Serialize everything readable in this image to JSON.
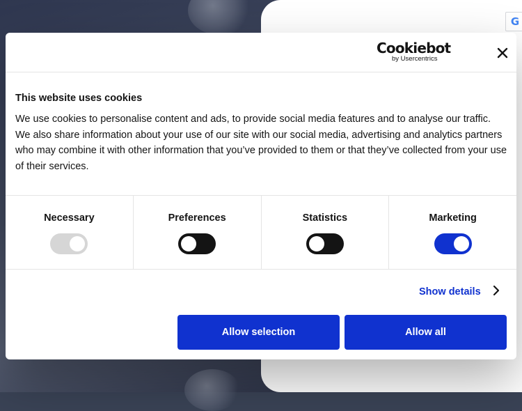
{
  "background": {
    "google_badge": "G",
    "colors": {
      "panel": "#ffffff",
      "accent_teal": "#22c9b1"
    }
  },
  "dialog": {
    "logo": {
      "main": "Cookiebot",
      "sub": "by Usercentrics"
    },
    "close_icon": "close-icon",
    "title": "This website uses cookies",
    "body": "We use cookies to personalise content and ads, to provide social media features and to analyse our traffic. We also share information about your use of our site with our social media, advertising and analytics partners who may combine it with other information that you’ve provided to them or that they’ve collected from your use of their services.",
    "categories": [
      {
        "label": "Necessary",
        "state": "on",
        "disabled": true
      },
      {
        "label": "Preferences",
        "state": "off",
        "disabled": false
      },
      {
        "label": "Statistics",
        "state": "off",
        "disabled": false
      },
      {
        "label": "Marketing",
        "state": "on",
        "disabled": false
      }
    ],
    "show_details": "Show details",
    "buttons": {
      "allow_selection": "Allow selection",
      "allow_all": "Allow all"
    },
    "colors": {
      "accent": "#1032cf",
      "toggle_off": "#141414",
      "toggle_disabled": "#d6d6d6"
    }
  }
}
